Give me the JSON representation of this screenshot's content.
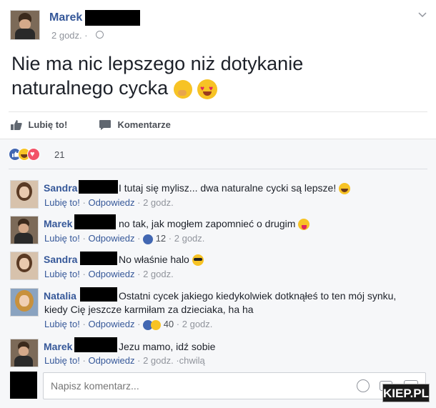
{
  "post": {
    "author": "Marek",
    "time": "2 godz.",
    "text_line1": "Nie ma nic lepszego niż dotykanie",
    "text_line2": "naturalnego cycka",
    "like_label": "Lubię to!",
    "comment_label": "Komentarze",
    "reactions_count": "21"
  },
  "comments": [
    {
      "author": "Sandra",
      "text": "I tutaj się mylisz... dwa naturalne cycki są lepsze!",
      "like": "Lubię to!",
      "reply": "Odpowiedz",
      "time": "2 godz."
    },
    {
      "author": "Marek",
      "text": "no tak, jak mogłem zapomnieć o drugim",
      "like": "Lubię to!",
      "reply": "Odpowiedz",
      "likes": "12",
      "time": "2 godz."
    },
    {
      "author": "Sandra",
      "text": "No właśnie halo",
      "like": "Lubię to!",
      "reply": "Odpowiedz",
      "time": "2 godz."
    },
    {
      "author": "Natalia",
      "text_line1": "Ostatni cycek jakiego kiedykolwiek dotknąłeś to ten mój synku,",
      "text_line2": "kiedy Cię jeszcze karmiłam za dzieciaka, ha ha",
      "like": "Lubię to!",
      "reply": "Odpowiedz",
      "likes": "40",
      "time": "2 godz."
    },
    {
      "author": "Marek",
      "text": "Jezu mamo, idź sobie",
      "like": "Lubię to!",
      "reply": "Odpowiedz",
      "time": "2 godz. ·chwilą"
    }
  ],
  "composer": {
    "placeholder": "Napisz komentarz..."
  },
  "watermark": "KIEP.PL",
  "icons": [
    "chevron-down-icon",
    "globe-icon",
    "thumbs-up-icon",
    "comment-icon",
    "like-reaction-icon",
    "haha-reaction-icon",
    "love-reaction-icon",
    "emoji-icon",
    "camera-icon",
    "gif-icon"
  ],
  "colors": {
    "link": "#365899",
    "meta": "#90949c",
    "like_blue": "#4267b2",
    "love_red": "#f25268",
    "emoji_yellow": "#f7c325"
  }
}
